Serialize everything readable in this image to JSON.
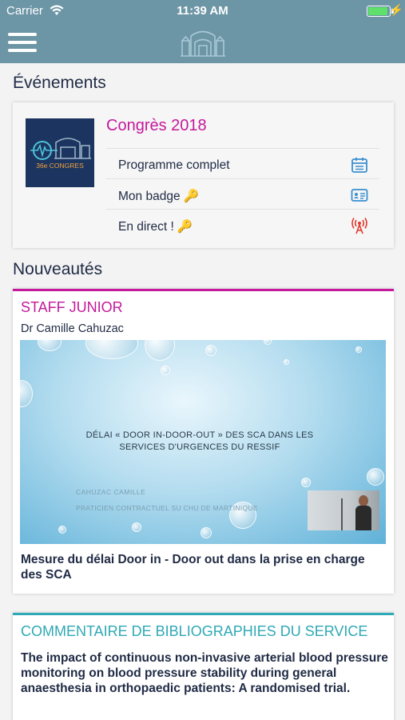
{
  "status_bar": {
    "carrier": "Carrier",
    "time": "11:39 AM"
  },
  "nav": {
    "menu_icon": "hamburger-icon",
    "logo_icon": "building-logo-icon"
  },
  "events_section": {
    "title": "Événements",
    "event": {
      "title": "Congrès 2018",
      "thumbnail_text": "36e CONGRES",
      "items": [
        {
          "label": "Programme complet",
          "icon": "calendar-icon"
        },
        {
          "label": "Mon badge",
          "icon": "badge-icon",
          "locked": true
        },
        {
          "label": "En direct !",
          "icon": "broadcast-icon",
          "locked": true
        }
      ]
    }
  },
  "news_section": {
    "title": "Nouveautés",
    "items": [
      {
        "category": "STAFF JUNIOR",
        "category_color": "#c4199a",
        "author": "Dr Camille Cahuzac",
        "slide": {
          "title": "DÉLAI « DOOR IN-DOOR-OUT » DES SCA DANS LES SERVICES D'URGENCES DU RESSIF",
          "subtitle_1": "CAHUZAC CAMILLE",
          "subtitle_2": "PRATICIEN CONTRACTUEL SU CHU DE MARTINIQUE"
        },
        "headline": "Mesure du délai Door in - Door out dans la prise en charge des SCA"
      },
      {
        "category": "COMMENTAIRE DE BIBLIOGRAPHIES DU SERVICE",
        "category_color": "#2fa9b5",
        "headline": "The impact of continuous non-invasive arterial blood pressure monitoring on blood pressure stability during general anaesthesia in orthopaedic patients: A randomised trial."
      }
    ]
  },
  "colors": {
    "header": "#6c95a6",
    "accent_pink": "#c4199a",
    "accent_teal": "#2fa9b5",
    "icon_blue": "#3a8fd0",
    "icon_red": "#e23a2e"
  }
}
